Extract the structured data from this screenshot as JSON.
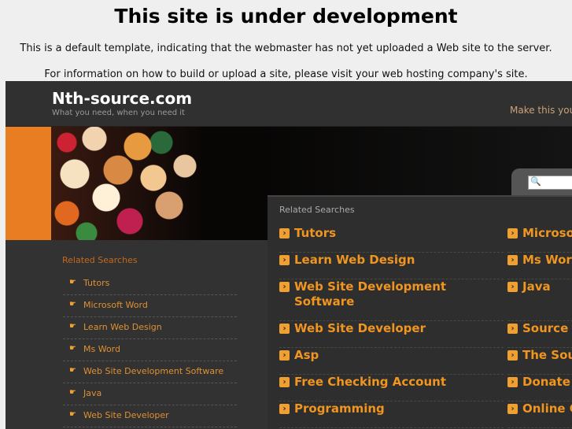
{
  "notice": {
    "title": "This site is under development",
    "line1": "This is a default template, indicating that the webmaster has not yet uploaded a Web site to the server.",
    "line2": "For information on how to build or upload a site, please visit your web hosting company's site."
  },
  "header": {
    "logo": "Nth-source.com",
    "tagline": "What you need, when you need it",
    "make_home": "Make this your"
  },
  "search": {
    "icon": "magnifier-icon",
    "value": ""
  },
  "sidebar": {
    "heading": "Related Searches",
    "items": [
      "Tutors",
      "Microsoft Word",
      "Learn Web Design",
      "Ms Word",
      "Web Site Development Software",
      "Java",
      "Web Site Developer"
    ]
  },
  "panel": {
    "heading": "Related Searches",
    "col1": [
      "Tutors",
      "Learn Web Design",
      "Web Site Development Software",
      "Web Site Developer",
      "Asp",
      "Free Checking Account",
      "Programming"
    ],
    "col2": [
      "Microsoft Word",
      "Ms Word",
      "Java",
      "Source",
      "The Sou",
      "Donate",
      "Online C"
    ]
  },
  "colors": {
    "accent": "#f0951f",
    "bg": "#2b2b2b"
  }
}
